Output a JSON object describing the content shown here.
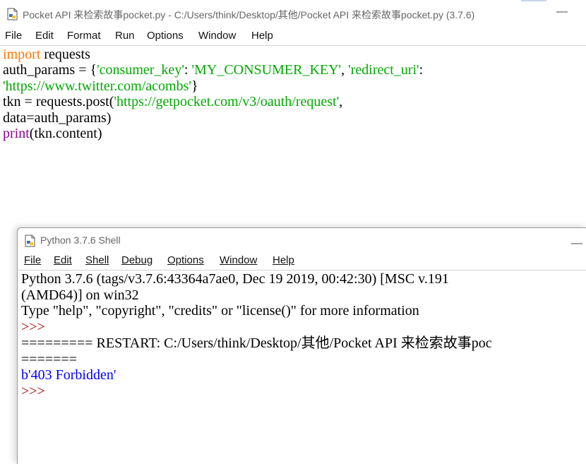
{
  "editor": {
    "title": "Pocket API 来检索故事pocket.py - C:/Users/think/Desktop/其他/Pocket API 来检索故事pocket.py (3.7.6)",
    "minimize_glyph": "—",
    "menu": [
      "File",
      "Edit",
      "Format",
      "Run",
      "Options",
      "Window",
      "Help"
    ],
    "code": {
      "l1_kw": "import",
      "l1_rest": " requests",
      "l2_a": "auth_params = {",
      "l2_s1": "'consumer_key'",
      "l2_b": ": ",
      "l2_s2": "'MY_CONSUMER_KEY'",
      "l2_c": ", ",
      "l2_s3": "'redirect_uri'",
      "l2_d": ":",
      "l3_s": "'https://www.twitter.com/acombs'",
      "l3_e": "}",
      "l4_a": "tkn = requests.post(",
      "l4_s": "'https://getpocket.com/v3/oauth/request'",
      "l4_e": ",",
      "l5": "data=auth_params)",
      "l6_kw": "print",
      "l6_rest": "(tkn.content)"
    }
  },
  "shell": {
    "title": "Python 3.7.6 Shell",
    "minimize_glyph": "—",
    "menu": [
      "File",
      "Edit",
      "Shell",
      "Debug",
      "Options",
      "Window",
      "Help"
    ],
    "output": {
      "l1": "Python 3.7.6 (tags/v3.7.6:43364a7ae0, Dec 19 2019, 00:42:30) [MSC v.191",
      "l2": "(AMD64)] on win32",
      "l3": "Type \"help\", \"copyright\", \"credits\" or \"license()\" for more information",
      "prompt": ">>>",
      "restart1": "========= RESTART: C:/Users/think/Desktop/其他/Pocket API 来检索故事poc",
      "restart2": "=======",
      "result": "b'403 Forbidden'"
    }
  }
}
